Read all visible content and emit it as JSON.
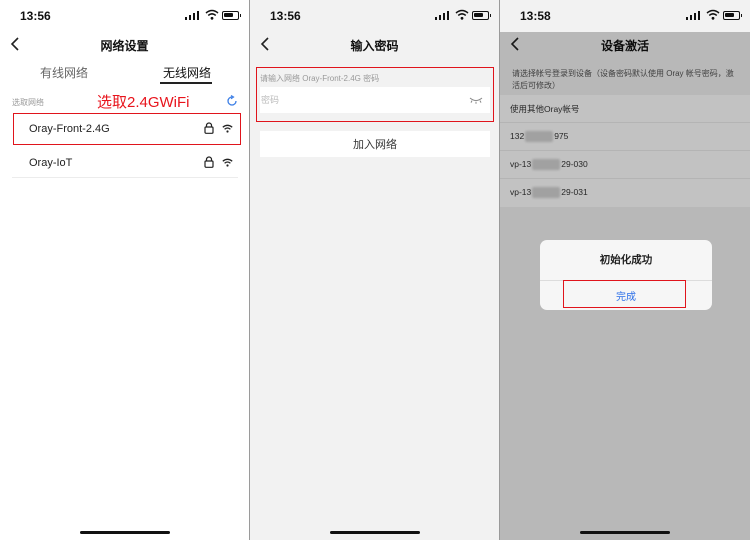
{
  "colors": {
    "accent_red": "#e0141c",
    "link_blue": "#2a6ee8",
    "overlay": "rgba(0,0,0,0.24)"
  },
  "panel1": {
    "status_time": "13:56",
    "title": "网络设置",
    "tabs": [
      {
        "label": "有线网络",
        "active": false
      },
      {
        "label": "无线网络",
        "active": true
      }
    ],
    "section_label": "选取网络",
    "annotation": "选取2.4GWiFi",
    "networks": [
      {
        "name": "Oray-Front-2.4G",
        "locked": true,
        "highlighted": true
      },
      {
        "name": "Oray-IoT",
        "locked": true,
        "highlighted": false
      }
    ]
  },
  "panel2": {
    "status_time": "13:56",
    "title": "输入密码",
    "password_label": "请输入网络 Oray-Front-2.4G 密码",
    "password_placeholder": "密码",
    "join_button": "加入网络"
  },
  "panel3": {
    "status_time": "13:58",
    "title": "设备激活",
    "prompt": "请选择帐号登录到设备（设备密码默认使用 Oray 帐号密码，激活后可修改）",
    "accounts": [
      {
        "prefix": "使用其他Oray帐号",
        "suffix": ""
      },
      {
        "prefix": "132",
        "suffix": "975"
      },
      {
        "prefix": "vp-13",
        "suffix": "29-030"
      },
      {
        "prefix": "vp-13",
        "suffix": "29-031"
      }
    ],
    "dialog_title": "初始化成功",
    "dialog_button": "完成"
  }
}
